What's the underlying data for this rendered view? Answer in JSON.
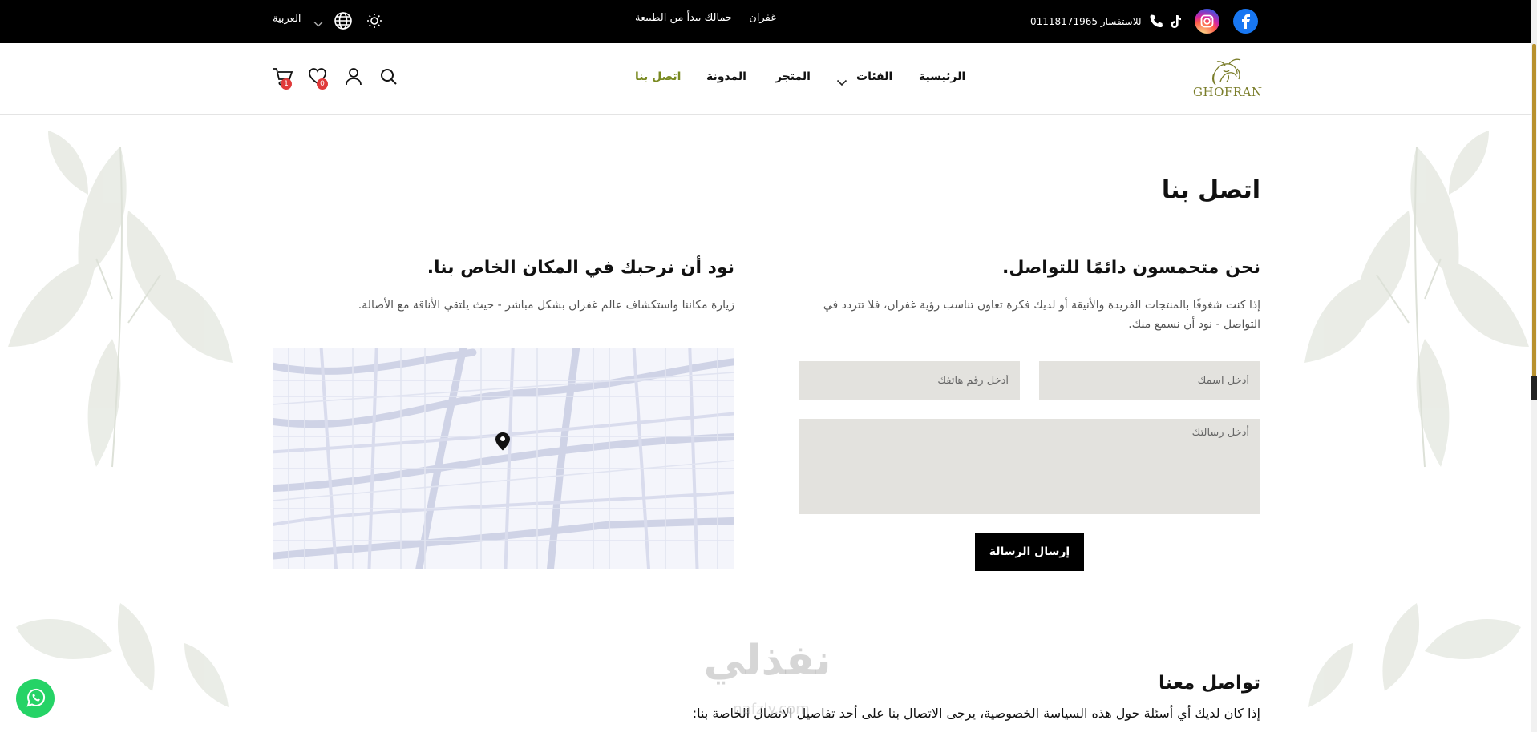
{
  "topbar": {
    "tagline": "غفران — جمالك يبدأ من الطبيعة",
    "phone_label": "للاستفسار 01118171965",
    "language": "العربية"
  },
  "nav": {
    "items": [
      {
        "label": "الرئيسية"
      },
      {
        "label": "الفئات"
      },
      {
        "label": "المتجر"
      },
      {
        "label": "المدونة"
      },
      {
        "label": "اتصل بنا"
      }
    ],
    "active_color": "#7a8a22"
  },
  "logo": {
    "text": "GHOFRAN"
  },
  "header_badges": {
    "wishlist_count": "0",
    "cart_count": "1"
  },
  "page": {
    "title": "اتصل بنا",
    "visit": {
      "heading": "نود أن نرحبك في المكان الخاص بنا.",
      "text": "زيارة مكاننا واستكشاف عالم غفران بشكل مباشر - حيث يلتقي الأناقة مع الأصالة."
    },
    "contact": {
      "heading": "نحن متحمسون دائمًا للتواصل.",
      "text": "إذا كنت شغوفًا بالمنتجات الفريدة والأنيقة أو لديك فكرة تعاون تناسب رؤية غفران، فلا تتردد في التواصل - نود أن نسمع منك."
    },
    "form": {
      "name_placeholder": "أدخل اسمك",
      "phone_placeholder": "أدخل رقم هاتفك",
      "message_placeholder": "أدخل رسالتك",
      "submit_label": "إرسال الرسالة"
    },
    "section2": {
      "title": "تواصل معنا",
      "text": "إذا كان لديك أي أسئلة حول هذه السياسة الخصوصية، يرجى الاتصال بنا على أحد تفاصيل الاتصال الخاصة بنا:"
    }
  },
  "watermark": {
    "arabic": "نفذلي",
    "latin": "nafzly.com"
  },
  "colors": {
    "topbar_bg": "#000000",
    "field_bg": "#e3e2de",
    "button_bg": "#000000",
    "badge": "#e03a3a",
    "whatsapp": "#25d366",
    "facebook": "#1877f2",
    "scroll_thumb": "#b8912e"
  },
  "icons": [
    "facebook-icon",
    "instagram-icon",
    "tiktok-icon",
    "phone-icon",
    "sun-icon",
    "globe-icon",
    "search-icon",
    "user-icon",
    "heart-icon",
    "cart-icon",
    "map-pin-icon",
    "whatsapp-icon"
  ]
}
